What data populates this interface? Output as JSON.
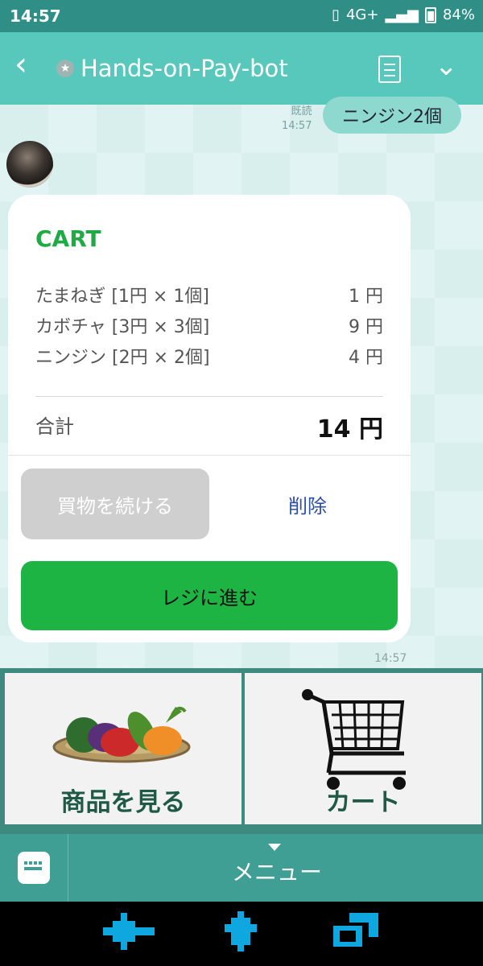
{
  "status_bar": {
    "time": "14:57",
    "network": "4G+",
    "battery": "84%"
  },
  "header": {
    "back_icon": "‹",
    "badge_icon": "★",
    "title": "Hands-on-Pay-bot",
    "menu_icon": "≡",
    "chevron_icon": "⌄"
  },
  "chat": {
    "sent_meta": {
      "read": "既読",
      "time": "14:57"
    },
    "sent_message": "ニンジン2個",
    "card": {
      "title": "CART",
      "items": [
        {
          "name": "たまねぎ [1円 × 1個]",
          "price": "1 円"
        },
        {
          "name": "カボチャ [3円 × 3個]",
          "price": "9 円"
        },
        {
          "name": "ニンジン [2円 × 2個]",
          "price": "4 円"
        }
      ],
      "total_label": "合計",
      "total_value": "14 円",
      "continue_button": "買物を続ける",
      "delete_button": "削除",
      "checkout_button": "レジに進む"
    },
    "received_time": "14:57"
  },
  "rich_menu": [
    {
      "label": "商品を見る",
      "icon": "vegetable-basket"
    },
    {
      "label": "カート",
      "icon": "shopping-cart"
    }
  ],
  "bottom_bar": {
    "menu_label": "メニュー",
    "keyboard_icon": "keyboard"
  },
  "colors": {
    "accent": "#1db444",
    "header": "#58c8bc",
    "status": "#2f8f87"
  }
}
